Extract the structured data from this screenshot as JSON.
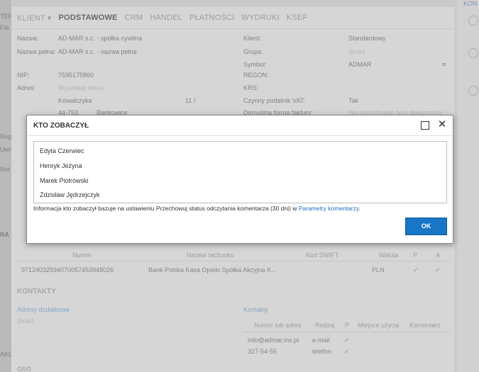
{
  "left_strip": {
    "labels": [
      "TER",
      "Fla",
      "Rep",
      "Uwi",
      "Not",
      "RA",
      "AKO"
    ]
  },
  "right_strip": {
    "label": "KON"
  },
  "tabs": [
    {
      "label": "KLIENT ▾",
      "active": false
    },
    {
      "label": "PODSTAWOWE",
      "active": true
    },
    {
      "label": "CRM",
      "active": false
    },
    {
      "label": "HANDEL",
      "active": false
    },
    {
      "label": "PŁATNOŚCI",
      "active": false
    },
    {
      "label": "WYDRUKI",
      "active": false
    },
    {
      "label": "KSEF",
      "active": false
    }
  ],
  "form": {
    "nazwa_label": "Nazwa:",
    "nazwa_value": "AD-MAR s.c. - spółka cywilna",
    "pelna_label": "Nazwa pełna:",
    "pelna_value": "AD-MAR s.c. - nazwa pełna",
    "nip_label": "NIP:",
    "nip_value": "7595175860",
    "adres_label": "Adres:",
    "adres_placeholder": "Wyszukaj adres...",
    "ulica": "Kowalczyka",
    "nr": "11 /",
    "kod": "44-753",
    "miasto": "Bierkowice",
    "klient_label": "Klient:",
    "klient_value": "Standardowy",
    "grupa_label": "Grupa:",
    "grupa_value": "(brak)",
    "symbol_label": "Symbol:",
    "symbol_value": "ADMAR",
    "regon_label": "REGON:",
    "krs_label": "KRS:",
    "vat_label": "Czynny podatnik VAT:",
    "vat_value": "Tak",
    "forma_label": "Domyślna forma faktury:",
    "forma_value": "Wg domyślnego typu dokumentu"
  },
  "bank": {
    "headers": {
      "numer": "Numer",
      "nazwa": "Nazwa rachunku",
      "swift": "Kod SWIFT",
      "waluta": "Waluta",
      "p": "P",
      "a": "A"
    },
    "row": {
      "numer": "97124032594070057453948026",
      "nazwa": "Bank Polska Kasa Opieki Spółka Akcyjna II...",
      "waluta": "PLN"
    }
  },
  "kontakty": {
    "title": "KONTAKTY",
    "adresy_label": "Adresy dodatkowe",
    "adresy_empty": "(brak)",
    "kontakty_label": "Kontakty",
    "headers": {
      "numer": "Numer lub adres",
      "rodzaj": "Rodzaj",
      "p": "P",
      "miejsce": "Miejsce użycia",
      "komentarz": "Komentarz"
    },
    "rows": [
      {
        "numer": "info@admar.ins.pl",
        "rodzaj": "e-mail"
      },
      {
        "numer": "327-54-55",
        "rodzaj": "telefon"
      }
    ],
    "bottom_label": "OSO"
  },
  "dialog": {
    "title": "KTO ZOBACZYŁ",
    "users": [
      "Edyta Czerwiec",
      "Henryk Jeżyna",
      "Marek Piotrowski",
      "Zdzisław Jędrzejczyk"
    ],
    "info_text": "Informacja kto zobaczył bazuje na ustawieniu Przechowuj status odczytania komentarza (30 dni) w ",
    "info_link": "Parametry komentarzy",
    "info_end": ".",
    "ok_label": "OK"
  }
}
